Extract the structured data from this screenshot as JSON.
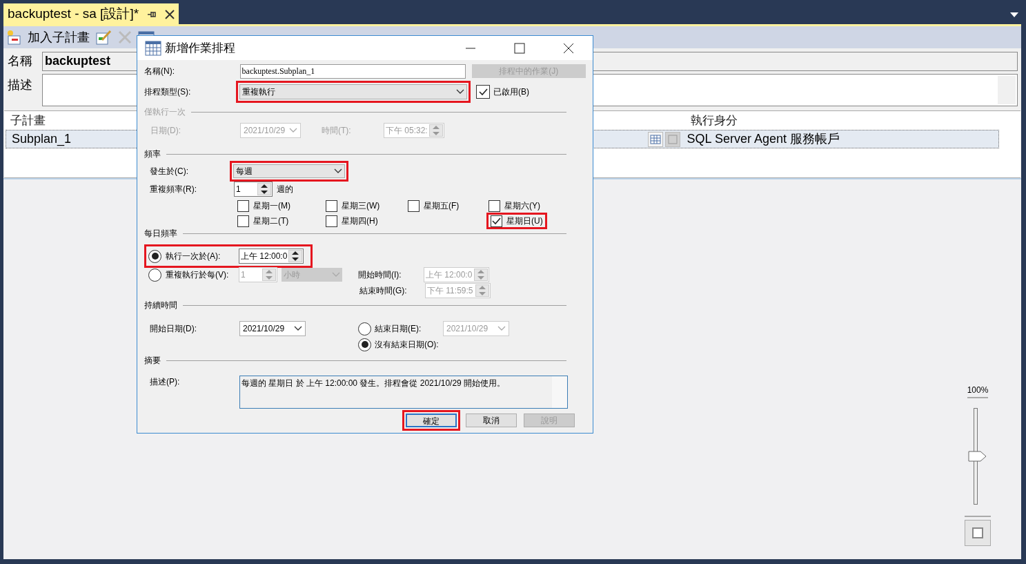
{
  "document_tab": {
    "title": "backuptest - sa [設計]*"
  },
  "toolbar": {
    "add_subplan": "加入子計畫"
  },
  "plan": {
    "name_label": "名稱",
    "name_value": "backuptest",
    "description_label": "描述"
  },
  "subplans": {
    "columns": [
      "子計畫",
      "執行身分"
    ],
    "rows": [
      {
        "name": "Subplan_1",
        "run_as": "SQL Server Agent 服務帳戶",
        "selected": true
      }
    ]
  },
  "zoom": {
    "reading": "100%",
    "level": 0.5
  },
  "dialog": {
    "title": "新增作業排程",
    "name": {
      "label": "名稱(N):",
      "value": "backuptest.Subplan_1"
    },
    "jobs_button": {
      "label": "排程中的作業(J)",
      "disabled": true
    },
    "schedule_type": {
      "label": "排程類型(S):",
      "value": "重複執行",
      "highlighted": true
    },
    "enabled": {
      "label": "已啟用(B)",
      "checked": true
    },
    "one_time": {
      "heading": "僅執行一次",
      "disabled": true,
      "date_label": "日期(D):",
      "date": "2021/10/29",
      "time_label": "時間(T):",
      "time": "下午 05:32:"
    },
    "frequency": {
      "heading": "頻率",
      "occurs_label": "發生於(C):",
      "occurs": "每週",
      "occurs_highlighted": true,
      "recurs_label": "重複頻率(R):",
      "recurs": "1",
      "recurs_unit": "週的",
      "day_columns": [
        [
          {
            "label": "星期一(M)",
            "checked": false,
            "highlighted": false
          },
          {
            "label": "星期二(T)",
            "checked": false,
            "highlighted": false
          }
        ],
        [
          {
            "label": "星期三(W)",
            "checked": false,
            "highlighted": false
          },
          {
            "label": "星期四(H)",
            "checked": false,
            "highlighted": false
          }
        ],
        [
          {
            "label": "星期五(F)",
            "checked": false,
            "highlighted": false
          }
        ],
        [
          {
            "label": "星期六(Y)",
            "checked": false,
            "highlighted": false
          },
          {
            "label": "星期日(U)",
            "checked": true,
            "highlighted": true
          }
        ]
      ]
    },
    "daily": {
      "heading": "每日頻率",
      "once": {
        "label": "執行一次於(A):",
        "selected": true,
        "time": "上午 12:00:0",
        "highlighted": true
      },
      "every": {
        "label": "重複執行於每(V):",
        "selected": false,
        "interval": "1",
        "unit": "小時"
      },
      "start_label": "開始時間(I):",
      "start": "上午 12:00:0",
      "end_label": "結束時間(G):",
      "end": "下午 11:59:5"
    },
    "duration": {
      "heading": "持續時間",
      "start_label": "開始日期(D):",
      "start": "2021/10/29",
      "end_date": {
        "label": "結束日期(E):",
        "selected": false,
        "date": "2021/10/29"
      },
      "no_end": {
        "label": "沒有結束日期(O):",
        "selected": true
      }
    },
    "summary": {
      "heading": "摘要",
      "label": "描述(P):",
      "text": "每週的 星期日 於 上午 12:00:00 發生。排程會從 2021/10/29 開始使用。"
    },
    "buttons": [
      {
        "label": "確定",
        "default": true,
        "disabled": false,
        "highlighted": true
      },
      {
        "label": "取消",
        "default": false,
        "disabled": false,
        "highlighted": false
      },
      {
        "label": "說明",
        "default": false,
        "disabled": true,
        "highlighted": false
      }
    ]
  }
}
